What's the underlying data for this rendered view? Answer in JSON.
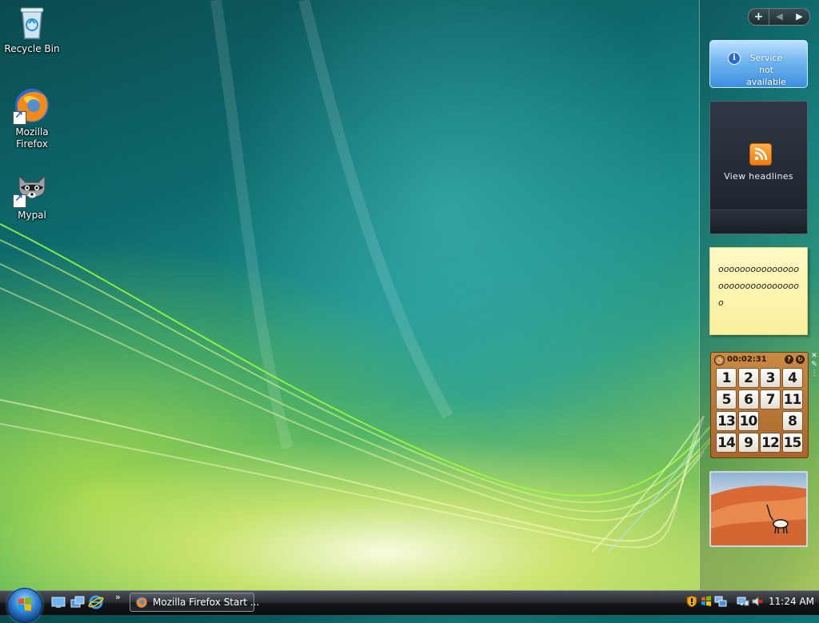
{
  "desktop": {
    "icons": [
      {
        "label": "Recycle Bin"
      },
      {
        "label": "Mozilla Firefox"
      },
      {
        "label": "Mypal"
      }
    ]
  },
  "sidebar": {
    "controls": {
      "add": "+",
      "prev": "◀",
      "next": "▶"
    },
    "weather": {
      "message": "Service not available"
    },
    "feed": {
      "label": "View headlines"
    },
    "notes": {
      "text": "ooooooooooooooooooooooooooooooo"
    },
    "puzzle": {
      "timer": "00:02:31",
      "tiles": [
        "1",
        "2",
        "3",
        "4",
        "5",
        "6",
        "7",
        "11",
        "13",
        "10",
        "",
        "8",
        "14",
        "9",
        "12",
        "15"
      ]
    }
  },
  "taskbar": {
    "tasks": [
      {
        "label": "Mozilla Firefox Start ..."
      }
    ],
    "clock": "11:24 AM"
  }
}
